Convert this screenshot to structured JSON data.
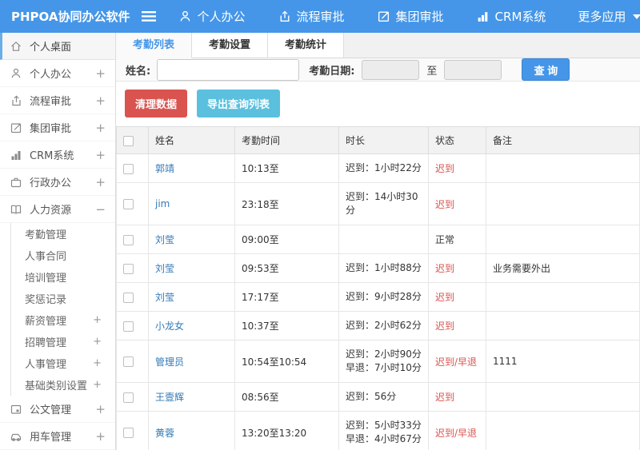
{
  "header": {
    "title": "PHPOA协同办公软件",
    "nav": [
      {
        "label": "个人办公"
      },
      {
        "label": "流程审批"
      },
      {
        "label": "集团审批"
      },
      {
        "label": "CRM系统"
      },
      {
        "label": "更多应用"
      }
    ]
  },
  "sidebar": {
    "items": [
      {
        "label": "个人桌面"
      },
      {
        "label": "个人办公",
        "expand": "+"
      },
      {
        "label": "流程审批",
        "expand": "+"
      },
      {
        "label": "集团审批",
        "expand": "+"
      },
      {
        "label": "CRM系统",
        "expand": "+"
      },
      {
        "label": "行政办公",
        "expand": "+"
      },
      {
        "label": "人力资源",
        "expand": "−"
      },
      {
        "label": "公文管理",
        "expand": "+"
      },
      {
        "label": "用车管理",
        "expand": "+"
      }
    ],
    "hr_children": [
      {
        "label": "考勤管理"
      },
      {
        "label": "人事合同"
      },
      {
        "label": "培训管理"
      },
      {
        "label": "奖惩记录"
      },
      {
        "label": "薪资管理",
        "expand": "+"
      },
      {
        "label": "招聘管理",
        "expand": "+"
      },
      {
        "label": "人事管理",
        "expand": "+"
      },
      {
        "label": "基础类别设置",
        "expand": "+"
      }
    ]
  },
  "tabs": [
    {
      "label": "考勤列表"
    },
    {
      "label": "考勤设置"
    },
    {
      "label": "考勤统计"
    }
  ],
  "filter": {
    "name_label": "姓名:",
    "date_label": "考勤日期:",
    "to_label": "至",
    "search_button": "查 询"
  },
  "toolbar": {
    "clean_button": "清理数据",
    "export_button": "导出查询列表"
  },
  "table": {
    "headers": [
      "姓名",
      "考勤时间",
      "时长",
      "状态",
      "备注"
    ],
    "rows": [
      {
        "name": "郭靖",
        "time": "10:13至",
        "dur1": "迟到：1小时22分",
        "dur2": "",
        "status": "迟到",
        "note": ""
      },
      {
        "name": "jim",
        "time": "23:18至",
        "dur1": "迟到：14小时30分",
        "dur2": "",
        "status": "迟到",
        "note": ""
      },
      {
        "name": "刘莹",
        "time": "09:00至",
        "dur1": "",
        "dur2": "",
        "status": "正常",
        "note": ""
      },
      {
        "name": "刘莹",
        "time": "09:53至",
        "dur1": "迟到：1小时88分",
        "dur2": "",
        "status": "迟到",
        "note": "业务需要外出"
      },
      {
        "name": "刘莹",
        "time": "17:17至",
        "dur1": "迟到：9小时28分",
        "dur2": "",
        "status": "迟到",
        "note": ""
      },
      {
        "name": "小龙女",
        "time": "10:37至",
        "dur1": "迟到：2小时62分",
        "dur2": "",
        "status": "迟到",
        "note": ""
      },
      {
        "name": "管理员",
        "time": "10:54至10:54",
        "dur1": "迟到：2小时90分",
        "dur2": "早退：7小时10分",
        "status": "迟到/早退",
        "note": "1111"
      },
      {
        "name": "王壹辉",
        "time": "08:56至",
        "dur1": "迟到：56分",
        "dur2": "",
        "status": "迟到",
        "note": ""
      },
      {
        "name": "黄蓉",
        "time": "13:20至13:20",
        "dur1": "迟到：5小时33分",
        "dur2": "早退：4小时67分",
        "status": "迟到/早退",
        "note": ""
      }
    ]
  },
  "colors": {
    "accent": "#4596e8",
    "danger": "#d9534f",
    "info": "#5bc0de",
    "link": "#337ab7"
  }
}
